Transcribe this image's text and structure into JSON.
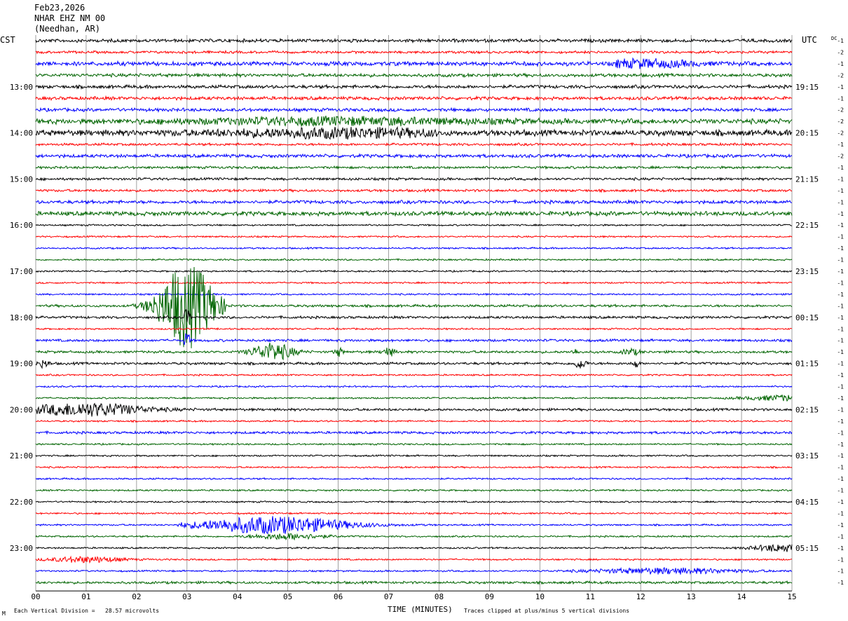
{
  "header": {
    "date": "Feb23,2026",
    "station": "NHAR EHZ NM 00",
    "location": "(Needhan, AR)",
    "left_tz": "CST",
    "right_tz": "UTC",
    "dc_label": "DC"
  },
  "footer": {
    "scale_text": "Each Vertical Division =   28.57 microvolts",
    "xlabel": "TIME (MINUTES)",
    "clip_text": "Traces clipped at plus/minus 5 vertical divisions",
    "corner_mark": "M"
  },
  "chart_data": {
    "type": "line",
    "title": "NHAR EHZ NM 00",
    "xlabel": "TIME (MINUTES)",
    "xlim": [
      0,
      15
    ],
    "x_ticks": [
      "00",
      "01",
      "02",
      "03",
      "04",
      "05",
      "06",
      "07",
      "08",
      "09",
      "10",
      "11",
      "12",
      "13",
      "14",
      "15"
    ],
    "trace_colors": [
      "#000000",
      "#ff0000",
      "#0000ff",
      "#006400"
    ],
    "minutes_per_line": 15,
    "left_hour_labels": [
      "13:00",
      "14:00",
      "15:00",
      "16:00",
      "17:00",
      "18:00",
      "19:00",
      "20:00",
      "21:00",
      "22:00",
      "23:00"
    ],
    "right_hour_labels": [
      "19:15",
      "20:15",
      "21:15",
      "22:15",
      "23:15",
      "00:15",
      "01:15",
      "02:15",
      "03:15",
      "04:15",
      "05:15"
    ],
    "dc_offsets": [
      "-1",
      "-2",
      "-1",
      "-2",
      "-1",
      "-1",
      "-2",
      "-2",
      "-2",
      "-1",
      "-2",
      "-1",
      "-1",
      "-1",
      "-1",
      "-1",
      "-1",
      "-1",
      "-1",
      "-1",
      "-1",
      "-1",
      "-1",
      "-1",
      "-1",
      "-1",
      "-1",
      "-1",
      "-1",
      "-1",
      "-1",
      "-1",
      "-1",
      "-1",
      "-1",
      "-1",
      "-1",
      "-1",
      "-1",
      "-1",
      "-1",
      "-1",
      "-1",
      "-1",
      "-1",
      "-1",
      "-1",
      "-1",
      "-1",
      "-1",
      "-1",
      "-1",
      "-2",
      "-1",
      "-1",
      "-1",
      "-1",
      "-2",
      "-1",
      "-1",
      "-1",
      "-1",
      "-1",
      "-1",
      "-1",
      "-1",
      "-1",
      "-1",
      "-1",
      "-1",
      "-1",
      "-1",
      "-1",
      "-1",
      "-1",
      "-1",
      "-1",
      "-1",
      "-1",
      "-1",
      "-1",
      "-1",
      "-1",
      "-1",
      "-1",
      "-1",
      "-1",
      "-1",
      "-1",
      "-1",
      "-1",
      "-1",
      "-1",
      "-1",
      "-1",
      "-1",
      "-1",
      "-1",
      "-1",
      "-1",
      "-1",
      "-1",
      "-1",
      "-1",
      "-1",
      "-1",
      "-1",
      "-1",
      "-1",
      "-1",
      "-1",
      "-1",
      "-1",
      "-1",
      "-1",
      "-1",
      "-1",
      "-1",
      "-1",
      "-1"
    ],
    "noise_levels": [
      2,
      1.5,
      2.5,
      2,
      2,
      2,
      2,
      3,
      3.5,
      1.5,
      2,
      1.5,
      1.5,
      1.5,
      2,
      2.5,
      1,
      1,
      1,
      1,
      1,
      1,
      1,
      1.5,
      1.5,
      1,
      1.5,
      1.5,
      1.5,
      1,
      1,
      1,
      1.5,
      1,
      1.5,
      1,
      1,
      1,
      1,
      1,
      1,
      1,
      1,
      1,
      1,
      1,
      1,
      1.5,
      1,
      1,
      1,
      2,
      2,
      1.5
    ],
    "events": [
      {
        "trace": 23,
        "start_min": 1.9,
        "end_min": 3.8,
        "peak_min": 3.0,
        "amplitude": 60
      },
      {
        "trace": 24,
        "start_min": 2.9,
        "end_min": 3.1,
        "peak_min": 3.0,
        "amplitude": 12
      },
      {
        "trace": 26,
        "start_min": 2.9,
        "end_min": 3.1,
        "peak_min": 3.0,
        "amplitude": 12
      },
      {
        "trace": 27,
        "start_min": 4.0,
        "end_min": 5.4,
        "peak_min": 4.7,
        "amplitude": 12
      },
      {
        "trace": 27,
        "start_min": 5.9,
        "end_min": 6.2,
        "peak_min": 6.0,
        "amplitude": 6
      },
      {
        "trace": 27,
        "start_min": 6.8,
        "end_min": 7.2,
        "peak_min": 7.0,
        "amplitude": 6
      },
      {
        "trace": 27,
        "start_min": 10.6,
        "end_min": 10.8,
        "peak_min": 10.7,
        "amplitude": 4
      },
      {
        "trace": 27,
        "start_min": 11.6,
        "end_min": 12.2,
        "peak_min": 11.8,
        "amplitude": 4
      },
      {
        "trace": 28,
        "start_min": 0.0,
        "end_min": 0.4,
        "peak_min": 0.15,
        "amplitude": 5
      },
      {
        "trace": 28,
        "start_min": 10.6,
        "end_min": 11.0,
        "peak_min": 10.8,
        "amplitude": 7
      },
      {
        "trace": 28,
        "start_min": 11.8,
        "end_min": 12.0,
        "peak_min": 11.9,
        "amplitude": 6
      },
      {
        "trace": 31,
        "start_min": 12.0,
        "end_min": 15.0,
        "peak_min": 15.0,
        "amplitude": 4
      },
      {
        "trace": 32,
        "start_min": 0.0,
        "end_min": 4.0,
        "peak_min": 1.0,
        "amplitude": 9
      },
      {
        "trace": 42,
        "start_min": 2.8,
        "end_min": 8.0,
        "peak_min": 4.7,
        "amplitude": 12
      },
      {
        "trace": 43,
        "start_min": 4.0,
        "end_min": 6.5,
        "peak_min": 5.0,
        "amplitude": 4
      },
      {
        "trace": 44,
        "start_min": 13.0,
        "end_min": 15.0,
        "peak_min": 14.8,
        "amplitude": 5
      },
      {
        "trace": 45,
        "start_min": 0.0,
        "end_min": 2.5,
        "peak_min": 1.0,
        "amplitude": 4
      },
      {
        "trace": 46,
        "start_min": 10.0,
        "end_min": 15.0,
        "peak_min": 12.5,
        "amplitude": 4
      },
      {
        "trace": 2,
        "start_min": 11.5,
        "end_min": 15.0,
        "peak_min": 12.0,
        "amplitude": 5
      },
      {
        "trace": 7,
        "start_min": 1.0,
        "end_min": 11.0,
        "peak_min": 6.0,
        "amplitude": 4
      },
      {
        "trace": 8,
        "start_min": 0.0,
        "end_min": 8.0,
        "peak_min": 6.0,
        "amplitude": 5
      }
    ]
  }
}
